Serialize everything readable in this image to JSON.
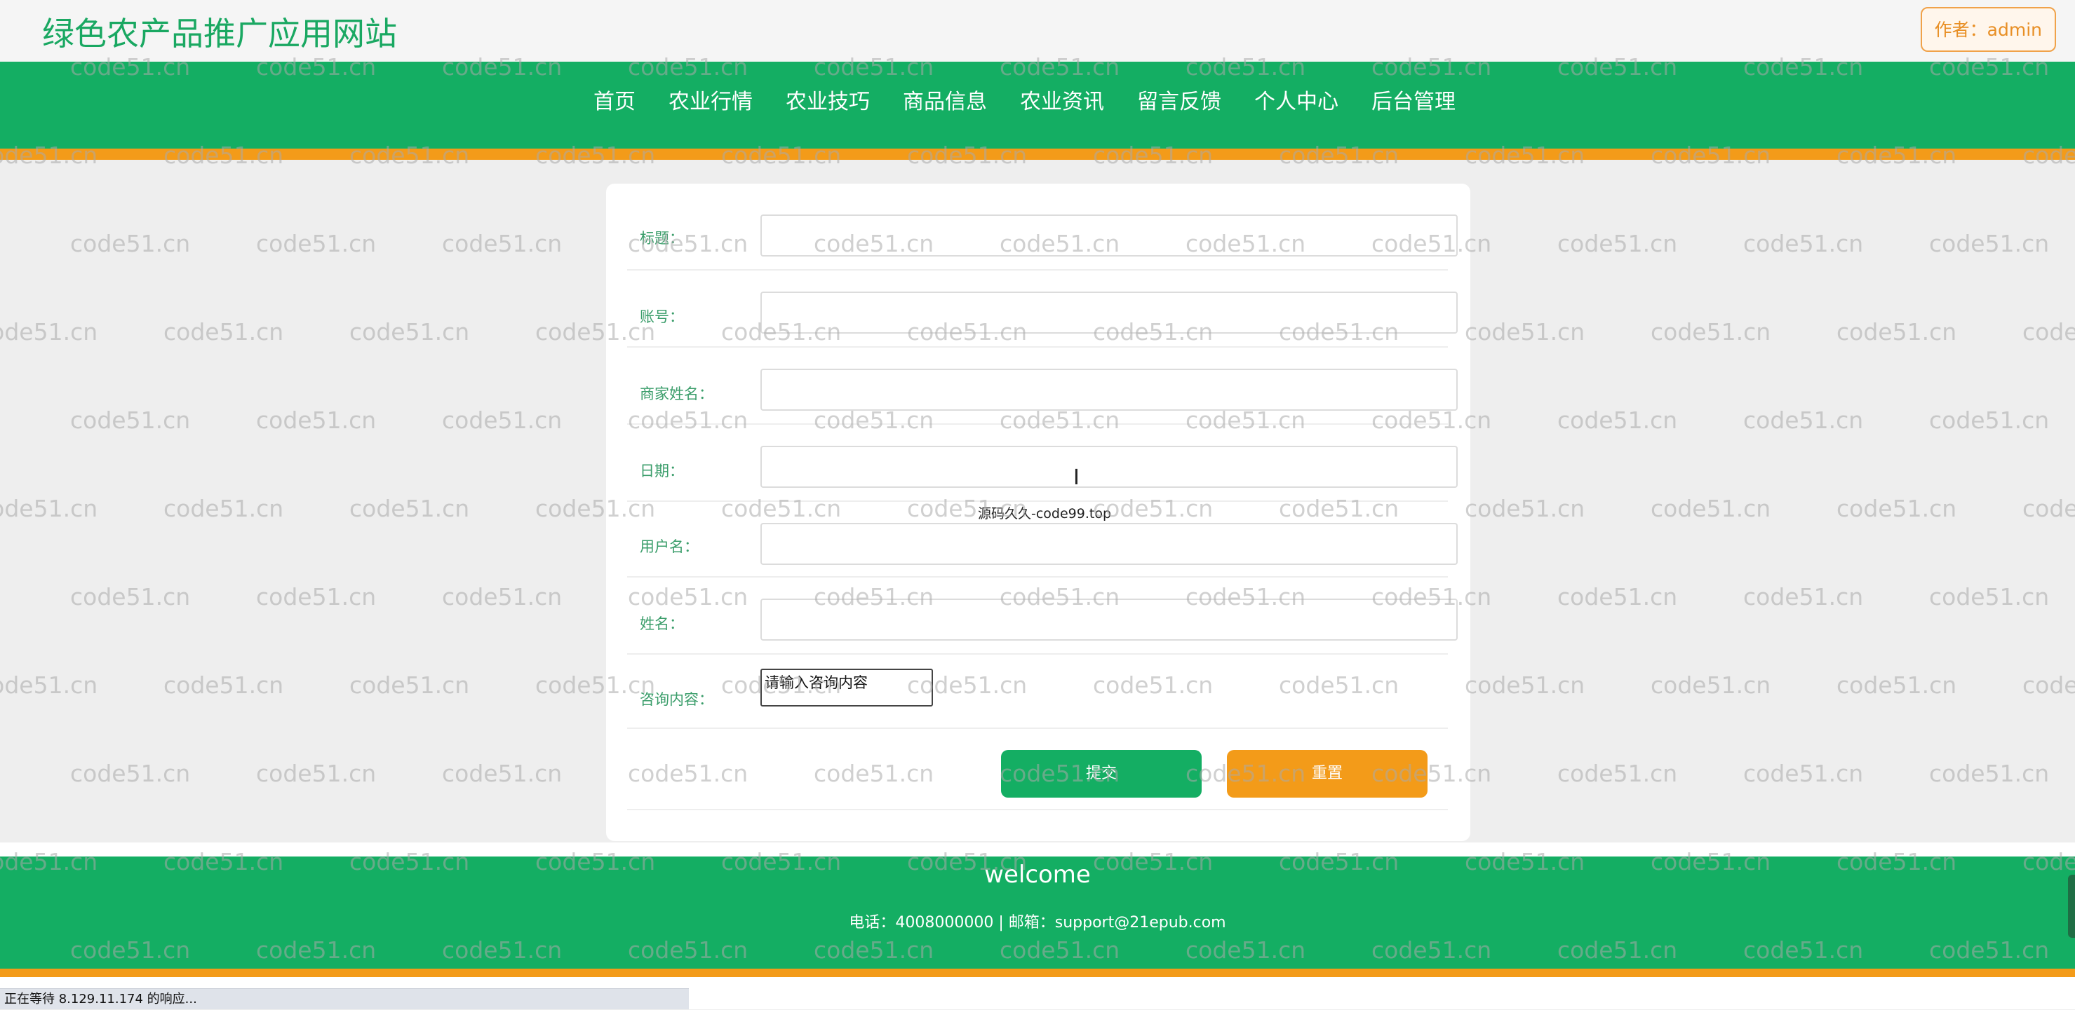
{
  "header": {
    "site_title": "绿色农产品推广应用网站",
    "author_button": "作者：admin"
  },
  "nav": {
    "items": [
      "首页",
      "农业行情",
      "农业技巧",
      "商品信息",
      "农业资讯",
      "留言反馈",
      "个人中心",
      "后台管理"
    ]
  },
  "form": {
    "fields": [
      {
        "label": "标题：",
        "value": ""
      },
      {
        "label": "账号：",
        "value": ""
      },
      {
        "label": "商家姓名：",
        "value": ""
      },
      {
        "label": "日期：",
        "value": ""
      },
      {
        "label": "用户名：",
        "value": ""
      },
      {
        "label": "姓名：",
        "value": ""
      }
    ],
    "consult_label": "咨询内容：",
    "consult_placeholder": "请输入咨询内容",
    "submit_label": "提交",
    "reset_label": "重置"
  },
  "overlay_text": "源码久久-code99.top",
  "footer": {
    "title": "welcome",
    "contact": "电话：4008000000 | 邮箱：support@21epub.com"
  },
  "browser_status": "正在等待 8.129.11.174 的响应...",
  "watermark": "code51.cn",
  "colors": {
    "brand_green": "#14ae63",
    "accent_orange": "#f39b19",
    "label_green": "#3a9d6a"
  }
}
